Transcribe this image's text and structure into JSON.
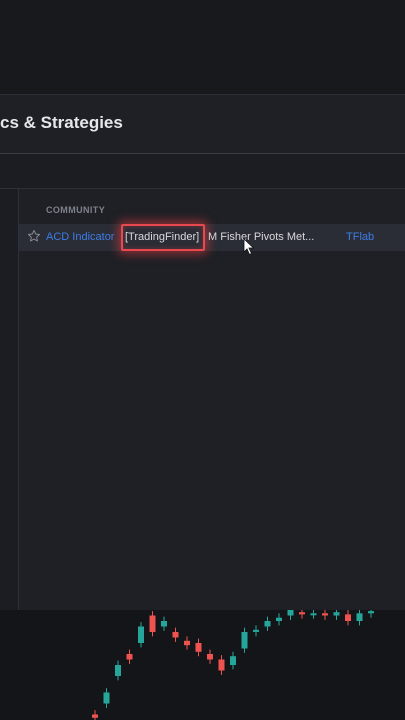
{
  "dialog": {
    "title": "cs & Strategies",
    "section_header": "COMMUNITY",
    "result": {
      "name_prefix": "ACD Indicator",
      "name_highlight": "[TradingFinder]",
      "name_rest": "M Fisher Pivots Met...",
      "author": "TFlab"
    }
  },
  "icons": {
    "star": "star-outline-icon",
    "cursor": "mouse-pointer-icon"
  },
  "colors": {
    "background": "#131519",
    "dialog": "#1e2025",
    "row_highlight": "#2a2d35",
    "link_blue": "#3d7de8",
    "highlight_red": "#e8494f",
    "candle_up": "#26a69a",
    "candle_down": "#ef5350"
  },
  "chart_data": {
    "type": "candlestick",
    "candles": [
      {
        "o": 0.05,
        "c": 0.02
      },
      {
        "o": 0.15,
        "c": 0.25
      },
      {
        "o": 0.4,
        "c": 0.5
      },
      {
        "o": 0.6,
        "c": 0.55
      },
      {
        "o": 0.7,
        "c": 0.85
      },
      {
        "o": 0.95,
        "c": 0.8
      },
      {
        "o": 0.85,
        "c": 0.9
      },
      {
        "o": 0.8,
        "c": 0.75
      },
      {
        "o": 0.72,
        "c": 0.68
      },
      {
        "o": 0.7,
        "c": 0.62
      },
      {
        "o": 0.6,
        "c": 0.55
      },
      {
        "o": 0.55,
        "c": 0.45
      },
      {
        "o": 0.5,
        "c": 0.58
      },
      {
        "o": 0.65,
        "c": 0.8
      },
      {
        "o": 0.8,
        "c": 0.82
      },
      {
        "o": 0.85,
        "c": 0.9
      },
      {
        "o": 0.9,
        "c": 0.93
      },
      {
        "o": 0.95,
        "c": 1.0
      },
      {
        "o": 0.98,
        "c": 0.96
      },
      {
        "o": 0.96,
        "c": 0.97
      },
      {
        "o": 0.97,
        "c": 0.95
      },
      {
        "o": 0.95,
        "c": 0.98
      },
      {
        "o": 0.96,
        "c": 0.9
      },
      {
        "o": 0.9,
        "c": 0.97
      },
      {
        "o": 0.97,
        "c": 0.99
      }
    ]
  }
}
